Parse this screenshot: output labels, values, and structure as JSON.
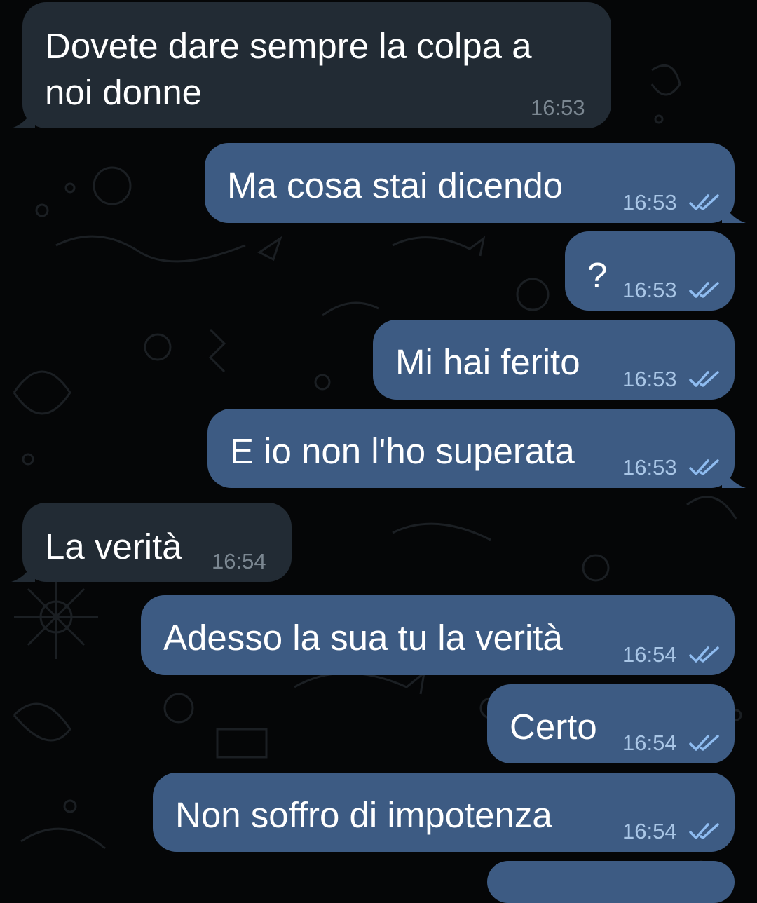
{
  "messages": [
    {
      "direction": "incoming",
      "text": "Dovete dare sempre la colpa a\nnoi donne",
      "time": "16:53"
    },
    {
      "direction": "outgoing",
      "text": "Ma cosa stai dicendo",
      "time": "16:53"
    },
    {
      "direction": "outgoing",
      "text": "?",
      "time": "16:53"
    },
    {
      "direction": "outgoing",
      "text": "Mi hai ferito",
      "time": "16:53"
    },
    {
      "direction": "outgoing",
      "text": "E io non l'ho superata",
      "time": "16:53"
    },
    {
      "direction": "incoming",
      "text": "La verità",
      "time": "16:54"
    },
    {
      "direction": "outgoing",
      "text": "Adesso la sua tu la verità",
      "time": "16:54"
    },
    {
      "direction": "outgoing",
      "text": "Certo",
      "time": "16:54"
    },
    {
      "direction": "outgoing",
      "text": "Non soffro di impotenza",
      "time": "16:54"
    },
    {
      "direction": "outgoing",
      "text": "",
      "time": ""
    }
  ],
  "colors": {
    "background": "#050607",
    "incoming_bubble": "#222b34",
    "outgoing_bubble": "#3d5b83",
    "read_ticks": "#8fbcf0"
  },
  "icons": {
    "read_status": "double-check-icon"
  }
}
